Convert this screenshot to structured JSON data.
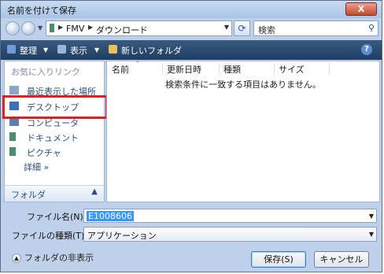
{
  "window": {
    "title": "名前を付けて保存",
    "close_label": "X"
  },
  "address": {
    "crumbs": [
      "FMV",
      "ダウンロード"
    ],
    "search_placeholder": "検索"
  },
  "toolbar": {
    "organize": "整理",
    "views": "表示",
    "new_folder": "新しいフォルダ",
    "help": "?"
  },
  "sidebar": {
    "header": "お気に入りリンク",
    "items": [
      {
        "label": "最近表示した場所",
        "icon": "recent-places-icon"
      },
      {
        "label": "デスクトップ",
        "icon": "desktop-icon"
      },
      {
        "label": "コンピュータ",
        "icon": "computer-icon"
      },
      {
        "label": "ドキュメント",
        "icon": "documents-icon"
      },
      {
        "label": "ピクチャ",
        "icon": "pictures-icon"
      }
    ],
    "detail": "詳細 »",
    "folders": "フォルダ"
  },
  "filelist": {
    "columns": [
      "名前",
      "更新日時",
      "種類",
      "サイズ"
    ],
    "empty_message": "検索条件に一致する項目はありません。"
  },
  "form": {
    "filename_label": "ファイル名(N):",
    "filename_value": "E1008606",
    "filetype_label": "ファイルの種類(T):",
    "filetype_value": "アプリケーション",
    "hide_folders": "フォルダの非表示",
    "save": "保存(S)",
    "cancel": "キャンセル"
  }
}
